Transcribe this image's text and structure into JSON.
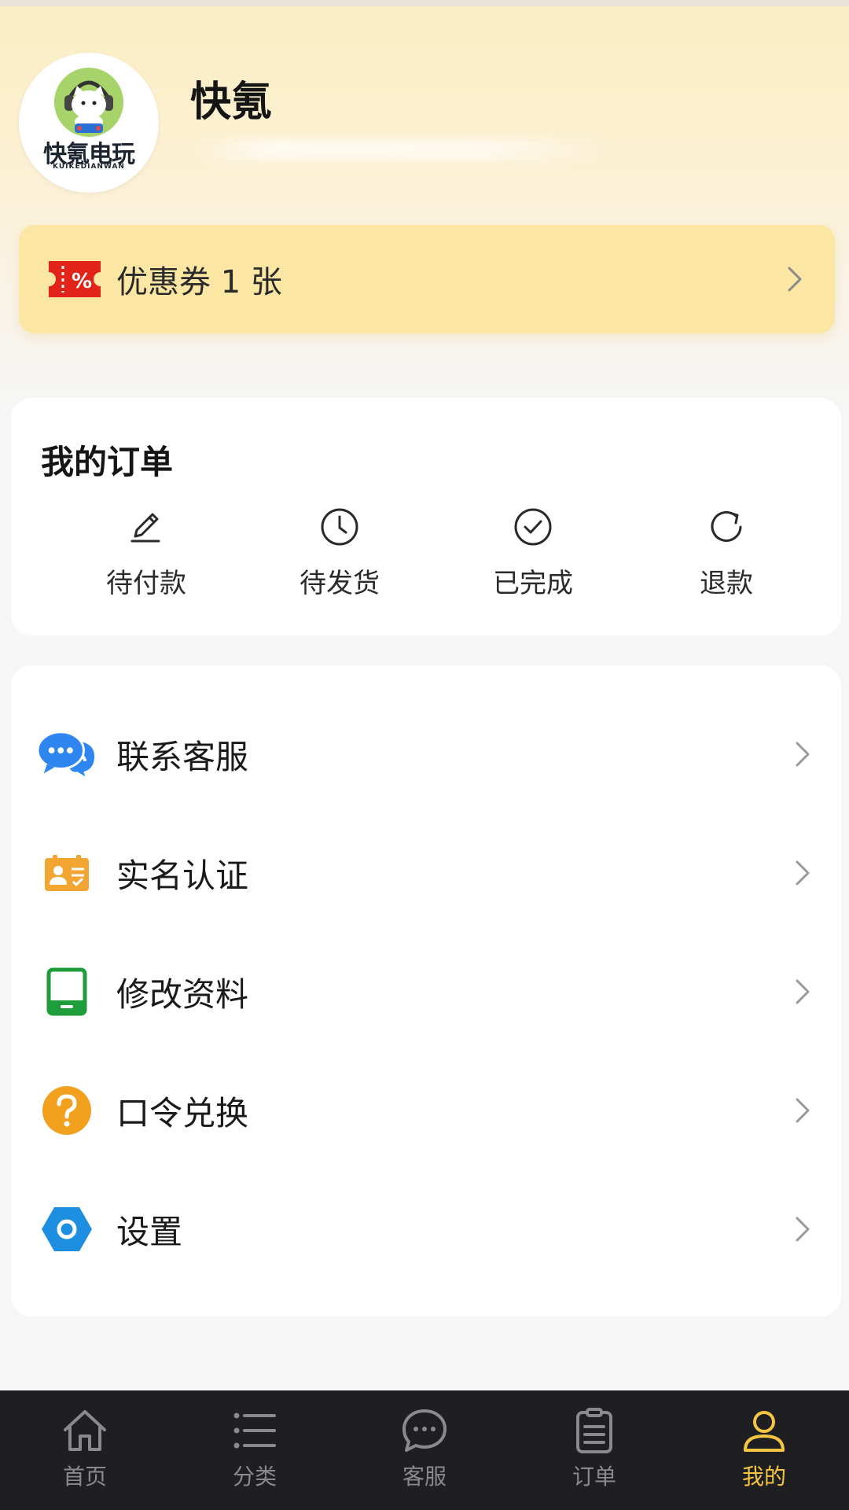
{
  "profile": {
    "name": "快氪",
    "avatar_logo_text": "快氪电玩",
    "avatar_logo_sub": "KUIKEDIANWAN"
  },
  "coupon": {
    "label": "优惠券 1 张",
    "icon": "coupon-percent-icon"
  },
  "orders": {
    "title": "我的订单",
    "items": [
      {
        "label": "待付款",
        "icon": "pencil-icon"
      },
      {
        "label": "待发货",
        "icon": "clock-icon"
      },
      {
        "label": "已完成",
        "icon": "check-circle-icon"
      },
      {
        "label": "退款",
        "icon": "refresh-icon"
      }
    ]
  },
  "menu": {
    "items": [
      {
        "label": "联系客服",
        "icon": "chat-bubbles-icon",
        "color": "#2f86f0"
      },
      {
        "label": "实名认证",
        "icon": "id-card-icon",
        "color": "#f3a532"
      },
      {
        "label": "修改资料",
        "icon": "tablet-icon",
        "color": "#1f9d3a"
      },
      {
        "label": "口令兑换",
        "icon": "question-icon",
        "color": "#f2a11f"
      },
      {
        "label": "设置",
        "icon": "settings-hex-icon",
        "color": "#1e8fe0"
      }
    ]
  },
  "tabbar": {
    "tabs": [
      {
        "label": "首页",
        "icon": "home-icon"
      },
      {
        "label": "分类",
        "icon": "list-icon"
      },
      {
        "label": "客服",
        "icon": "chat-icon"
      },
      {
        "label": "订单",
        "icon": "clipboard-icon"
      },
      {
        "label": "我的",
        "icon": "user-icon",
        "active": true
      }
    ],
    "active_color": "#f5c542"
  }
}
